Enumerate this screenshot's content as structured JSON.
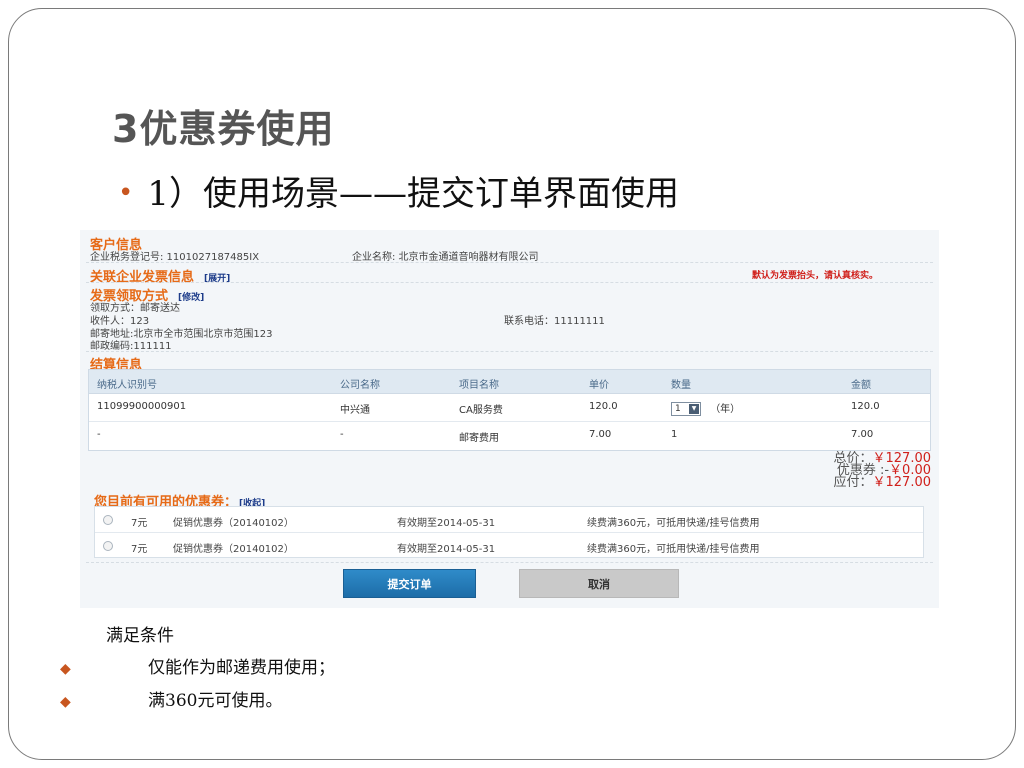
{
  "slide": {
    "title": "3优惠券使用",
    "subtitle_bullet": "•",
    "subtitle": "1）使用场景——提交订单界面使用"
  },
  "customer": {
    "section_title": "客户信息",
    "tax_label": "企业税务登记号: 1101027187485IX",
    "company_label": "企业名称: 北京市金通道音响器材有限公司"
  },
  "invoice": {
    "section_title": "关联企业发票信息",
    "expand_link": "[展开]",
    "notice": "默认为发票抬头，请认真核实。"
  },
  "delivery": {
    "section_title": "发票领取方式",
    "edit_link": "[修改]",
    "method": "领取方式：邮寄送达",
    "recipient": "收件人：123",
    "phone": "联系电话：11111111",
    "address": "邮寄地址:北京市全市范围北京市范围123",
    "postcode": "邮政编码:111111"
  },
  "settlement": {
    "section_title": "结算信息",
    "columns": [
      "纳税人识别号",
      "公司名称",
      "项目名称",
      "单价",
      "数量",
      "金额"
    ],
    "rows": [
      {
        "tax_id": "11099900000901",
        "company": "中兴通",
        "item": "CA服务费",
        "price": "120.0",
        "qty": "1",
        "unit": "（年）",
        "amount": "120.0"
      },
      {
        "tax_id": "-",
        "company": "-",
        "item": "邮寄费用",
        "price": "7.00",
        "qty": "1",
        "unit": "",
        "amount": "7.00"
      }
    ]
  },
  "totals": {
    "total_label": "总价：",
    "total_value": "￥127.00",
    "coupon_label": "优惠券 :-",
    "coupon_value": "￥0.00",
    "pay_label": "应付：",
    "pay_value": "￥127.00"
  },
  "coupons": {
    "section_title": "您目前有可用的优惠券：",
    "collapse_link": "[收起]",
    "items": [
      {
        "value": "7元",
        "name": "促销优惠券（20140102）",
        "validity": "有效期至2014-05-31",
        "rule": "续费满360元，可抵用快递/挂号信费用"
      },
      {
        "value": "7元",
        "name": "促销优惠券（20140102）",
        "validity": "有效期至2014-05-31",
        "rule": "续费满360元，可抵用快递/挂号信费用"
      }
    ]
  },
  "buttons": {
    "submit": "提交订单",
    "cancel": "取消"
  },
  "conditions": {
    "title": "满足条件",
    "bullet": "◆",
    "items": [
      "仅能作为邮递费用使用；",
      "满360元可使用。"
    ]
  },
  "colors": {
    "accent_orange": "#e66a17",
    "accent_red": "#d0201b",
    "button_blue": "#1d6da8",
    "bullet_orange": "#c8561f"
  }
}
